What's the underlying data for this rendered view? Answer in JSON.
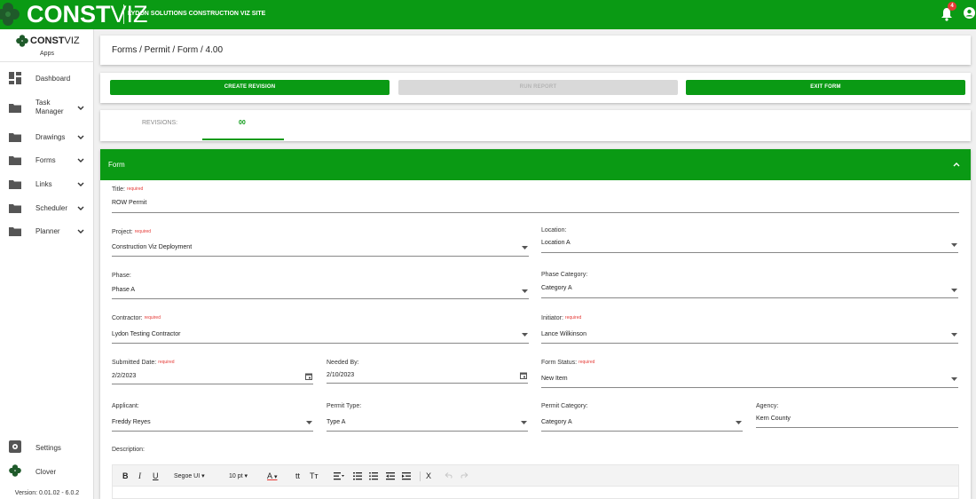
{
  "topbar": {
    "brand_bold": "CONST",
    "brand_light": "VIZ",
    "site_title": "LYDON SOLUTIONS CONSTRUCTION VIZ SITE",
    "notification_count": "4",
    "accent_color": "#0a9a14"
  },
  "sidebar": {
    "logo_bold": "CONST",
    "logo_light": "VIZ",
    "apps_label": "Apps",
    "items": [
      {
        "label": "Dashboard",
        "icon": "dashboard-icon"
      },
      {
        "label": "Task Manager",
        "icon": "folder-icon"
      },
      {
        "label": "Drawings",
        "icon": "folder-icon"
      },
      {
        "label": "Forms",
        "icon": "folder-icon"
      },
      {
        "label": "Links",
        "icon": "folder-icon"
      },
      {
        "label": "Scheduler",
        "icon": "folder-icon"
      },
      {
        "label": "Planner",
        "icon": "folder-icon"
      }
    ],
    "bottom_items": [
      {
        "label": "Settings",
        "icon": "settings-icon"
      },
      {
        "label": "Clover",
        "icon": "clover-icon"
      }
    ],
    "version": "Version: 0.01.02 - 6.0.2"
  },
  "breadcrumb": "Forms / Permit / Form / 4.00",
  "actions": {
    "create_revision": "CREATE REVISION",
    "run_report": "RUN REPORT",
    "exit_form": "EXIT FORM"
  },
  "tabs": {
    "revisions_label": "REVISIONS:",
    "revision_value": "00"
  },
  "form": {
    "header": "Form",
    "required_text": "required",
    "title": {
      "label": "Title:",
      "value": "ROW Permit"
    },
    "project": {
      "label": "Project:",
      "value": "Construction Viz Deployment"
    },
    "location": {
      "label": "Location:",
      "value": "Location A"
    },
    "phase": {
      "label": "Phase:",
      "value": "Phase A"
    },
    "phase_category": {
      "label": "Phase Category:",
      "value": "Category A"
    },
    "contractor": {
      "label": "Contractor:",
      "value": "Lydon Testing Contractor"
    },
    "initiator": {
      "label": "Initiator:",
      "value": "Lance Wilkinson"
    },
    "submitted_date": {
      "label": "Submitted Date:",
      "value": "2/2/2023"
    },
    "needed_by": {
      "label": "Needed By:",
      "value": "2/10/2023"
    },
    "form_status": {
      "label": "Form Status:",
      "value": "New Item"
    },
    "applicant": {
      "label": "Applicant:",
      "value": "Freddy Reyes"
    },
    "permit_type": {
      "label": "Permit Type:",
      "value": "Type A"
    },
    "permit_category": {
      "label": "Permit Category:",
      "value": "Category A"
    },
    "agency": {
      "label": "Agency:",
      "value": "Kern County"
    },
    "description_label": "Description:"
  },
  "editor_toolbar": {
    "bold": "B",
    "italic": "I",
    "underline": "U",
    "font_family": "Segoe UI",
    "font_size": "10 pt",
    "font_color": "A",
    "superscript": "tt",
    "font_case": "Tт",
    "clear_format": "X"
  }
}
